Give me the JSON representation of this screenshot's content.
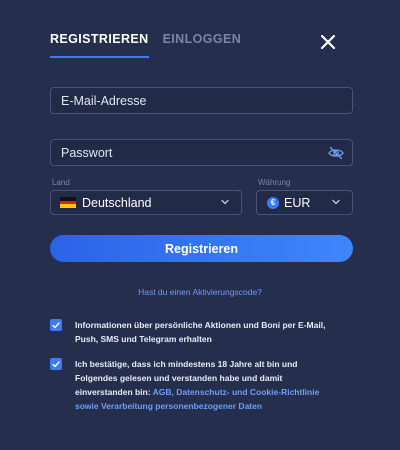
{
  "tabs": [
    {
      "label": "REGISTRIEREN",
      "active": true
    },
    {
      "label": "EINLOGGEN",
      "active": false
    }
  ],
  "form": {
    "email_placeholder": "E-Mail-Adresse",
    "password_placeholder": "Passwort",
    "country_label": "Land",
    "country_value": "Deutschland",
    "currency_label": "Währung",
    "currency_value": "EUR",
    "currency_symbol": "€",
    "submit_label": "Registrieren",
    "promo_link": "Hast du einen Aktivierungscode?"
  },
  "consents": [
    {
      "checked": true,
      "lines": [
        "Informationen über persönliche Aktionen und Boni per E-Mail,",
        "Push, SMS und Telegram erhalten"
      ]
    },
    {
      "checked": true,
      "lines": [
        "Ich bestätige, dass ich mindestens 18 Jahre alt bin und",
        "Folgendes gelesen und verstanden habe und damit"
      ],
      "prefix": "einverstanden bin: ",
      "link_line1": "AGB, Datenschutz- und Cookie-Richtlinie",
      "link_line2": "sowie Verarbeitung personenbezogener Daten"
    }
  ],
  "colors": {
    "background": "#252e4d",
    "accent": "#3b7bf6",
    "link": "#6f9ef8",
    "muted": "#7a84a3"
  }
}
